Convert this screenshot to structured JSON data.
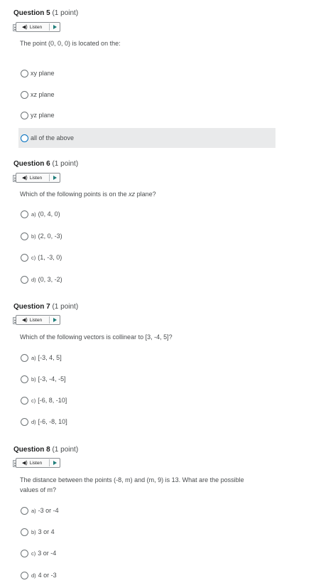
{
  "listen_label": "Listen",
  "questions": [
    {
      "number_label": "Question 5",
      "points": "(1 point)",
      "stem": "The point (0, 0, 0) is located on the:",
      "options": [
        {
          "text": "xy plane"
        },
        {
          "text": "xz plane"
        },
        {
          "text": "yz plane"
        },
        {
          "text": "all of the above"
        }
      ]
    },
    {
      "number_label": "Question 6",
      "points": "(1 point)",
      "stem_before": "Which of the following points is on the ",
      "stem_italic": "xz",
      "stem_after": " plane?",
      "options": [
        {
          "letter": "a)",
          "value": "(0, 4, 0)"
        },
        {
          "letter": "b)",
          "value": "(2, 0, -3)"
        },
        {
          "letter": "c)",
          "value": "(1, -3, 0)"
        },
        {
          "letter": "d)",
          "value": "(0, 3, -2)"
        }
      ]
    },
    {
      "number_label": "Question 7",
      "points": "(1 point)",
      "stem": "Which of the following vectors is collinear to [3, -4, 5]?",
      "options": [
        {
          "letter": "a)",
          "value": "[-3, 4, 5]"
        },
        {
          "letter": "b)",
          "value": "[-3, -4, -5]"
        },
        {
          "letter": "c)",
          "value": "[-6, 8, -10]"
        },
        {
          "letter": "d)",
          "value": "[-6, -8, 10]"
        }
      ]
    },
    {
      "number_label": "Question 8",
      "points": "(1 point)",
      "stem_line1": "The distance between the points (-8, m) and (m, 9) is 13.  What are the possible",
      "stem_line2": "values of m?",
      "options": [
        {
          "letter": "a)",
          "value": "-3 or -4"
        },
        {
          "letter": "b)",
          "value": "3 or 4"
        },
        {
          "letter": "c)",
          "value": "3 or -4"
        },
        {
          "letter": "d)",
          "value": "4 or -3"
        }
      ]
    }
  ]
}
